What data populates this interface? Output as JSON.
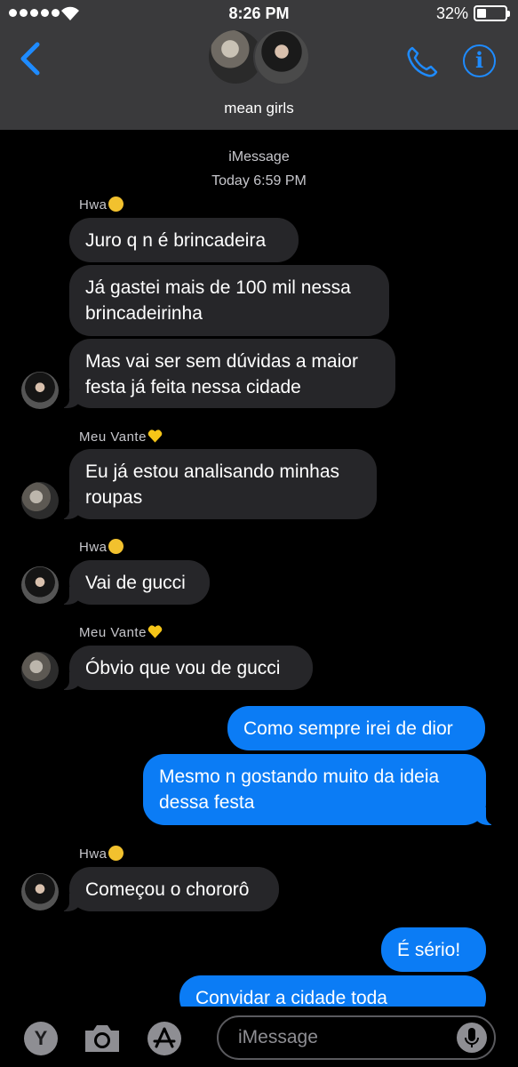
{
  "status": {
    "time": "8:26 PM",
    "battery": "32%"
  },
  "header": {
    "group_name": "mean girls"
  },
  "chat": {
    "service": "iMessage",
    "timestamp": "Today 6:59 PM",
    "senders": {
      "hwa": "Hwa",
      "vante": "Meu Vante"
    },
    "messages": [
      "Juro q n é brincadeira",
      "Já gastei mais de 100 mil nessa",
      "brincadeirinha",
      "Mas vai ser sem dúvidas a maior",
      "festa já feita nessa cidade",
      "Eu já estou analisando minhas",
      "roupas",
      "Vai de gucci",
      "Óbvio que vou de gucci",
      "Como sempre irei de dior",
      "Mesmo n gostando muito da ideia",
      "dessa festa",
      "Começou o chororô",
      "É sério!",
      "Convidar a cidade toda"
    ]
  },
  "input": {
    "placeholder": "iMessage",
    "apps_letter": "Y"
  },
  "colors": {
    "accent": "#1e8bff",
    "outgoing": "#0b7cf5",
    "incoming": "#262629",
    "header": "#3a3a3c"
  }
}
